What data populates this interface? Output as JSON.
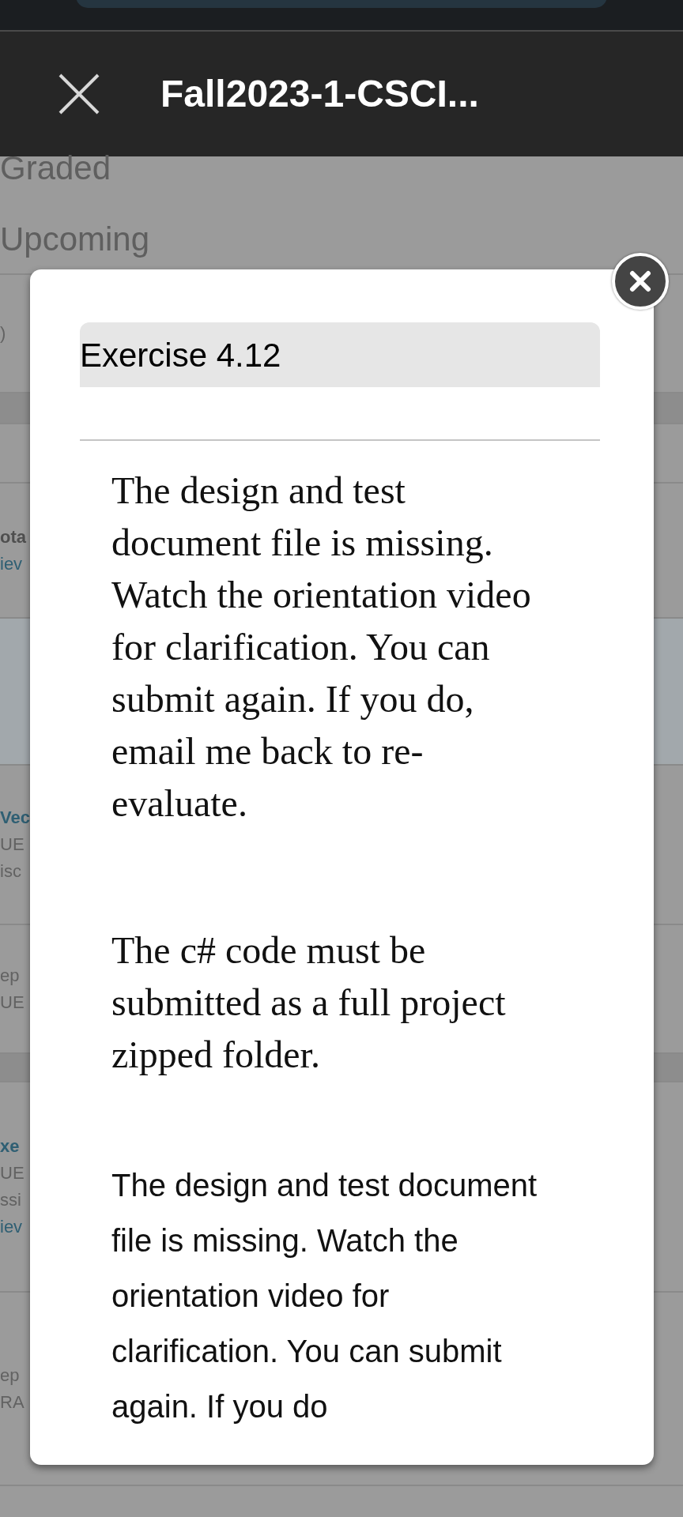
{
  "header": {
    "title": "Fall2023-1-CSCI..."
  },
  "background": {
    "tabs": [
      {
        "label": "Graded"
      },
      {
        "label": "Upcoming"
      }
    ],
    "rows": [
      {
        "kind": "item",
        "lines": [
          {
            "kind": "meta",
            "text": ")"
          }
        ]
      },
      {
        "kind": "band",
        "lines": []
      },
      {
        "kind": "item",
        "lines": []
      },
      {
        "kind": "item",
        "lines": [
          {
            "kind": "bold",
            "text": "ota"
          },
          {
            "kind": "link",
            "text": "iev"
          }
        ]
      },
      {
        "kind": "highlight",
        "lines": []
      },
      {
        "kind": "item",
        "lines": [
          {
            "kind": "title",
            "text": "Vec"
          },
          {
            "kind": "meta",
            "text": "UE"
          },
          {
            "kind": "meta",
            "text": "isc"
          }
        ]
      },
      {
        "kind": "item",
        "lines": [
          {
            "kind": "meta",
            "text": "ep"
          },
          {
            "kind": "meta",
            "text": "UE"
          }
        ]
      },
      {
        "kind": "band",
        "lines": []
      },
      {
        "kind": "item",
        "lines": [
          {
            "kind": "title",
            "text": "xe"
          },
          {
            "kind": "meta",
            "text": "UE"
          },
          {
            "kind": "meta",
            "text": "ssi"
          },
          {
            "kind": "link",
            "text": "iev"
          }
        ]
      },
      {
        "kind": "item",
        "lines": [
          {
            "kind": "meta",
            "text": "ep"
          },
          {
            "kind": "meta",
            "text": "RA"
          }
        ]
      }
    ]
  },
  "modal": {
    "title": "Exercise 4.12",
    "feedback": [
      "The design and test document file is missing. Watch the orientation video for clarification. You can submit again. If you do, email me back to re-evaluate.",
      "The c# code must be submitted as a full project zipped folder."
    ],
    "text": "The design and test document file is missing. Watch the orientation video for clarification. You can submit again. If you do"
  }
}
